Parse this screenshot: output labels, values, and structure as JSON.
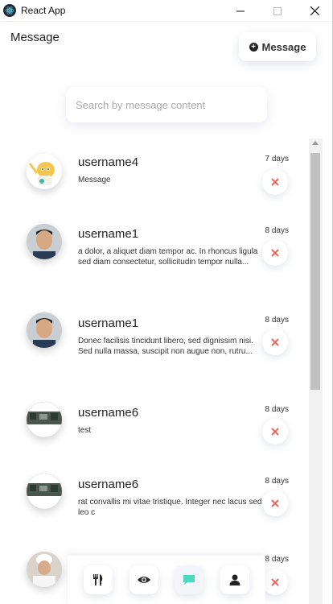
{
  "window": {
    "title": "React App"
  },
  "header": {
    "title": "Message",
    "new_button_label": "Message"
  },
  "search": {
    "placeholder": "Search by message content",
    "value": ""
  },
  "messages": [
    {
      "username": "username4",
      "preview": "Message",
      "age": "7 days",
      "avatar": "cartoon-character"
    },
    {
      "username": "username1",
      "preview": "a dolor, a aliquet diam tempor ac. In rhoncus ligula sed diam consectetur, sollicitudin tempor nulla...",
      "age": "8 days",
      "avatar": "man-portrait"
    },
    {
      "username": "username1",
      "preview": "Donec facilisis tincidunt libero, sed dignissim nisi. Sed nulla massa, suscipit non augue non, rutru...",
      "age": "8 days",
      "avatar": "man-portrait"
    },
    {
      "username": "username6",
      "preview": "test",
      "age": "8 days",
      "avatar": "kitchen-photo"
    },
    {
      "username": "username6",
      "preview": "rat convallis mi vitae tristique. Integer nec lacus sed leo c",
      "age": "8 days",
      "avatar": "kitchen-photo"
    },
    {
      "username": "",
      "preview": "",
      "age": "8 days",
      "avatar": "chef-portrait"
    }
  ],
  "nav": [
    {
      "icon": "utensils-icon",
      "active": false
    },
    {
      "icon": "eye-icon",
      "active": false
    },
    {
      "icon": "chat-icon",
      "active": true
    },
    {
      "icon": "user-icon",
      "active": false
    }
  ],
  "colors": {
    "accent": "#4dd9c0",
    "delete": "#e8685f",
    "scrollbar_thumb": "#c1c1c1"
  }
}
